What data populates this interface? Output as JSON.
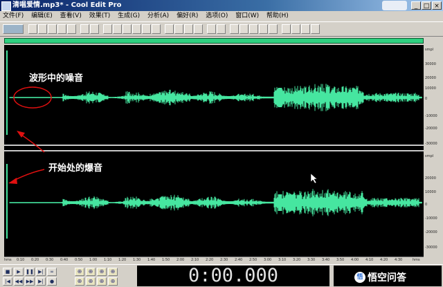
{
  "window": {
    "title": "清唱爱情.mp3* - Cool Edit Pro",
    "minimize": "_",
    "maximize": "□",
    "close": "×"
  },
  "menu": [
    {
      "label": "文件(F)"
    },
    {
      "label": "编辑(E)"
    },
    {
      "label": "查看(V)"
    },
    {
      "label": "效果(T)"
    },
    {
      "label": "生成(G)"
    },
    {
      "label": "分析(A)"
    },
    {
      "label": "偏好(R)"
    },
    {
      "label": "选项(O)"
    },
    {
      "label": "窗口(W)"
    },
    {
      "label": "帮助(H)"
    }
  ],
  "annotations": {
    "noise_label": "波形中的噪音",
    "pop_label": "开始处的爆音"
  },
  "ruler": {
    "unit": "smpl",
    "top_ticks": [
      "30000",
      "20000",
      "10000",
      "0",
      "-10000",
      "-20000",
      "-30000"
    ],
    "bottom_ticks": [
      "20000",
      "10000",
      "0",
      "-10000",
      "-20000",
      "-30000"
    ]
  },
  "timeline": {
    "unit": "hms",
    "labels": [
      "0:10",
      "0:20",
      "0:30",
      "0:40",
      "0:50",
      "1:00",
      "1:10",
      "1:20",
      "1:30",
      "1:40",
      "1:50",
      "2:00",
      "2:10",
      "2:20",
      "2:30",
      "2:40",
      "2:50",
      "3:00",
      "3:10",
      "3:20",
      "3:30",
      "3:40",
      "3:50",
      "4:00",
      "4:10",
      "4:20",
      "4:30",
      "hms"
    ]
  },
  "time_display": "0:00.000",
  "watermark": {
    "circle": "悟",
    "text": "悟空问答"
  },
  "colors": {
    "waveform": "#46e6a0",
    "background": "#000000",
    "annotation": "#e01010",
    "overview": "#2fd080"
  },
  "icons": {
    "toolbar": [
      "mode-switch-icon",
      "new-icon",
      "open-icon",
      "save-icon",
      "save-all-icon",
      "close-file-icon",
      "undo-icon",
      "redo-icon",
      "copy-icon",
      "copy-new-icon",
      "cut-icon",
      "paste-icon",
      "paste-new-icon",
      "mix-paste-icon",
      "crop-icon",
      "select-all-icon",
      "loop-icon",
      "normalize-icon",
      "silence-icon",
      "amplify-icon",
      "waveform-view-icon",
      "spectral-view-icon",
      "tone-icon",
      "noise-reduce-icon",
      "eq-icon",
      "metronome-icon",
      "settings-icon",
      "cd-icon",
      "help-icon"
    ],
    "transport": [
      "stop-icon",
      "play-icon",
      "pause-icon",
      "play-to-end-icon",
      "loop-play-icon",
      "go-start-icon",
      "rewind-icon",
      "fast-forward-icon",
      "go-end-icon",
      "record-icon"
    ],
    "zoom": [
      "zoom-in-h-icon",
      "zoom-out-h-icon",
      "zoom-full-icon",
      "zoom-in-v-icon",
      "zoom-out-v-icon",
      "zoom-selection-icon",
      "zoom-left-icon",
      "zoom-right-icon"
    ]
  }
}
